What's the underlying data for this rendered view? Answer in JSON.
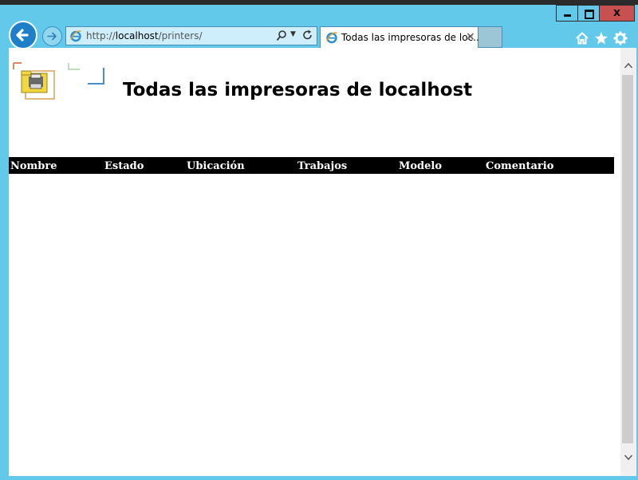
{
  "browser": {
    "back_icon": "back-arrow-icon",
    "forward_icon": "forward-arrow-icon",
    "address_bar": {
      "scheme": "http://",
      "host": "localhost",
      "path": "/printers/"
    },
    "tab": {
      "title": "Todas las impresoras de loc...",
      "close_label": "×"
    },
    "window_controls": {
      "minimize_icon": "minimize-icon",
      "maximize_icon": "maximize-icon",
      "close_label": "x"
    },
    "toolbar_icons": [
      "home-icon",
      "favorites-star-icon",
      "settings-gear-icon"
    ]
  },
  "page": {
    "title": "Todas las impresoras de localhost",
    "table": {
      "columns": [
        "Nombre",
        "Estado",
        "Ubicación",
        "Trabajos",
        "Modelo",
        "Comentario"
      ],
      "rows": []
    }
  },
  "colors": {
    "chrome": "#63c9ea",
    "close_button": "#c75050",
    "table_header_bg": "#000000",
    "table_header_text": "#ffffff"
  }
}
